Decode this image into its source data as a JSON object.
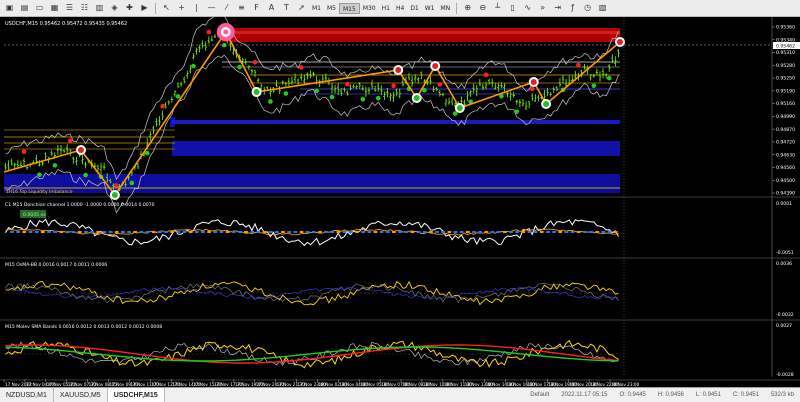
{
  "toolbar": {
    "timeframes": [
      "M1",
      "M5",
      "M15",
      "M30",
      "H1",
      "H4",
      "D1",
      "W1",
      "MN"
    ],
    "active_timeframe": "M15",
    "icons": [
      "new-chart-icon",
      "profiles-icon",
      "open-icon",
      "save-icon",
      "market-watch-icon",
      "navigator-icon",
      "terminal-icon",
      "tester-icon",
      "new-order-icon",
      "autotrading-icon",
      "cursor-icon",
      "crosshair-icon",
      "vertical-line-icon",
      "horizontal-line-icon",
      "trendline-icon",
      "channel-icon",
      "fibo-icon",
      "text-icon",
      "label-icon",
      "arrow-icon",
      "zoom-in-icon",
      "zoom-out-icon",
      "chart-bars-icon",
      "chart-candles-icon",
      "chart-line-icon",
      "autoscroll-icon",
      "chart-shift-icon",
      "indicators-icon",
      "periods-icon",
      "templates-icon"
    ]
  },
  "chart": {
    "symbol_label": "USDCHF,M15  0.95462 0.95472 0.95435 0.95462",
    "inner_label": "1H16 Top Liquidity Imbalance",
    "price_labels": [
      "0.95360",
      "0.95340",
      "0.95310",
      "0.95280",
      "0.95250",
      "0.95190",
      "0.95160",
      "0.94990",
      "0.94870",
      "0.94720",
      "0.94630",
      "0.94560",
      "0.94500",
      "0.94390"
    ],
    "current_price": "0.95462",
    "colors": {
      "ohlc": "#7cfc00",
      "zigzag": "#ff9900",
      "resistance": "#b00000",
      "support": "#1414d2",
      "band": "#c8c8c8",
      "up_dot": "#22cc22",
      "down_dot": "#ff2020"
    }
  },
  "panes": [
    {
      "label": "C1 M15 Donchian channel 1.0000 -1.0000 0.0000 0.0014 0.0070",
      "badge": "0.0045 xx",
      "scale_top": "0.0001",
      "scale_bottom": "-0.0051"
    },
    {
      "label": "M15 OsMA-BB 0.0016 0.0017 0.0011 0.0006",
      "scale_top": "0.0036",
      "scale_bottom": "-0.0032"
    },
    {
      "label": "M15 Molev SMA Bands 0.0016 0.0012 0.0013 0.0012 0.0012 0.0008",
      "scale_top": "0.0027",
      "scale_bottom": "-0.0028"
    }
  ],
  "time_labels": [
    "17 Nov 2022",
    "17 Nov 04:00",
    "17 Nov 05:30",
    "17 Nov 07:30",
    "17 Nov 08:15",
    "17 Nov 09:30",
    "17 Nov 11:00",
    "17 Nov 12:30",
    "17 Nov 14:00",
    "17 Nov 15:30",
    "17 Nov 17:30",
    "17 Nov 19:00",
    "17 Nov 20:30",
    "17 Nov 21:30",
    "17 Nov 23:00",
    "18 Nov 02:30",
    "18 Nov 04:00",
    "18 Nov 05:30",
    "18 Nov 07:00",
    "18 Nov 08:30",
    "18 Nov 10:00",
    "18 Nov 11:30",
    "18 Nov 13:00",
    "18 Nov 14:30",
    "18 Nov 16:00",
    "18 Nov 17:30",
    "18 Nov 19:00",
    "18 Nov 20:30",
    "18 Nov 22:00",
    "18 Nov 23:00"
  ],
  "tabs": [
    {
      "label": "NZDUSD,M1",
      "active": false
    },
    {
      "label": "XAUUSD,M5",
      "active": false
    },
    {
      "label": "USDCHF,M15",
      "active": true
    }
  ],
  "status_bar": {
    "profile": "Default",
    "datetime": "2022.11.17 05:15",
    "open": "O: 0.9445",
    "high": "H: 0.9456",
    "low": "L: 0.9451",
    "close": "C: 0.9451",
    "traffic": "532/3 kb"
  }
}
